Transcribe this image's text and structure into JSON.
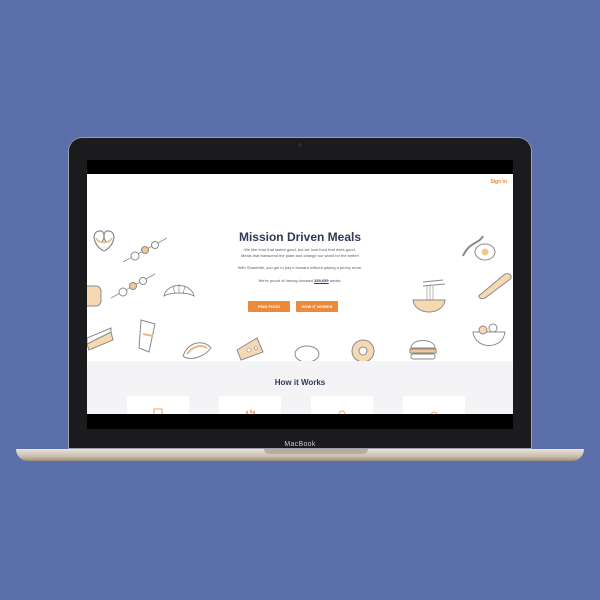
{
  "device": {
    "brand_label": "MacBook"
  },
  "header": {
    "signin_label": "Sign in"
  },
  "hero": {
    "title": "Mission Driven Meals",
    "line1": "We like food that tastes good, but we love food that does good.",
    "line2": "Meals that transcend the plate and change our world for the better!",
    "line3": "With Sharebite, you get to pay it forward without paying a penny more.",
    "line4_prefix": "We're proud of having donated ",
    "meals_count": "339,659",
    "line4_suffix": " meals.",
    "find_food_label": "FIND FOOD",
    "how_it_works_label": "HOW IT WORKS"
  },
  "how_section": {
    "title": "How it Works"
  },
  "colors": {
    "background": "#5b6faa",
    "accent": "#ec8a3b",
    "heading": "#2f3a5a",
    "doodle_fill": "#f6d9b3"
  }
}
